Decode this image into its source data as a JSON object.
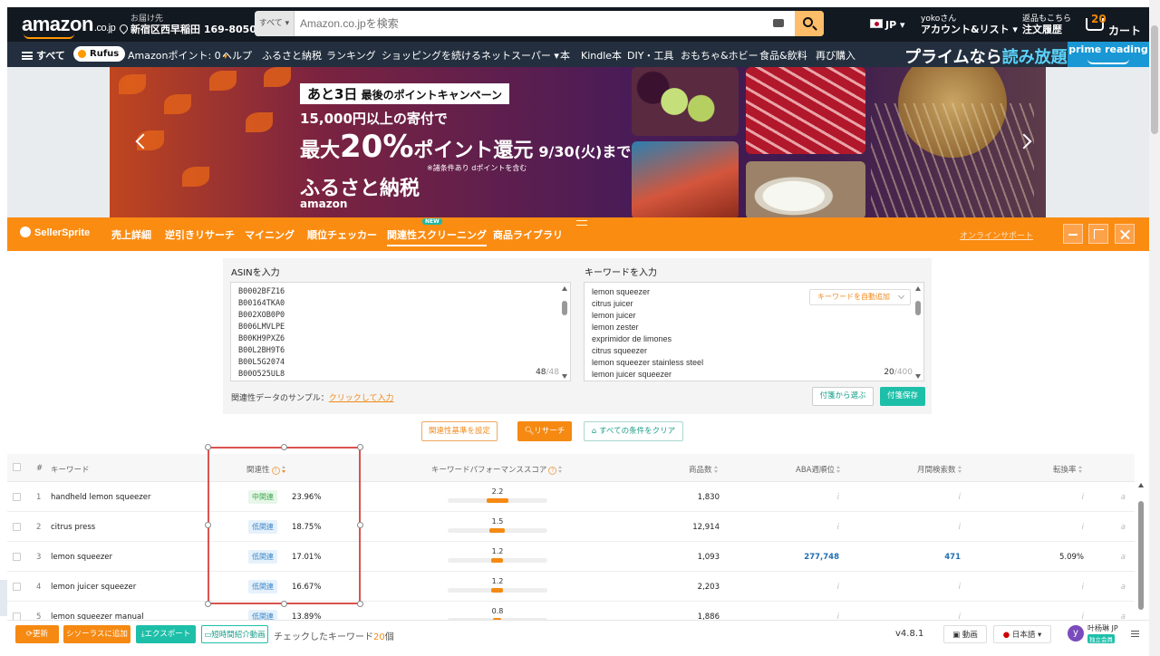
{
  "amazon": {
    "logo": "amazon",
    "logo_suffix": ".co.jp",
    "deliver_label": "お届け先",
    "deliver_addr": "新宿区西早稲田 169-8050",
    "search_category": "すべて",
    "search_placeholder": "Amazon.co.jpを検索",
    "lang": "JP",
    "account_hello": "yokoさん",
    "account_label": "アカウント&リスト",
    "returns_l1": "返品もこちら",
    "returns_l2": "注文履歴",
    "cart_count": "20",
    "cart_label": "カート"
  },
  "nav": {
    "all": "すべて",
    "rufus": "Rufus",
    "items": [
      "Amazonポイント: 0",
      "ヘルプ",
      "ふるさと納税",
      "ランキング",
      "ショッピングを続ける",
      "ネットスーパー",
      "本",
      "Kindle本",
      "DIY・工具",
      "おもちゃ&ホビー",
      "食品&飲料",
      "再び購入"
    ],
    "promo_a": "プライムなら",
    "promo_b": "読み放題",
    "prime_reading": "prime reading"
  },
  "banner": {
    "tag_a": "あと3日",
    "tag_b": "最後のポイントキャンペーン",
    "line2": "15,000円以上の寄付で",
    "line3_a": "最大",
    "line3_big": "20%",
    "line3_b": "ポイント還元",
    "line3_date": "9/30(火)まで",
    "note": "※諸条件あり dポイントを含む",
    "line4": "ふるさと納税",
    "brand": "amazon"
  },
  "sellersprite": {
    "logo": "SellerSprite",
    "tabs": [
      "売上詳細",
      "逆引きリサーチ",
      "マイニング",
      "順位チェッカー",
      "関連性スクリーニング",
      "商品ライブラリ"
    ],
    "new_badge": "NEW",
    "support": "オンラインサポート"
  },
  "form": {
    "asin_label": "ASINを入力",
    "keyword_label": "キーワードを入力",
    "asins": [
      "B0002BFZ16",
      "B00164TKA0",
      "B002XOB0P0",
      "B006LMVLPE",
      "B00KH9PXZ6",
      "B00L2BH9T6",
      "B00L5G2074",
      "B00O525UL8"
    ],
    "asin_count": "48",
    "asin_max": "/48",
    "keywords": [
      "lemon squeezer",
      "citrus juicer",
      "lemon juicer",
      "lemon zester",
      "exprimidor de limones",
      "citrus squeezer",
      "lemon squeezer stainless steel",
      "lemon juicer squeezer"
    ],
    "keyword_count": "20",
    "keyword_max": "/400",
    "auto_add": "キーワードを自動追加",
    "sample_label": "関連性データのサンプル：",
    "sample_link": "クリックして入力",
    "select_btn": "付箋から選ぶ",
    "save_btn": "付箋保存",
    "criteria_btn": "関連性基準を設定",
    "research_btn": "リサーチ",
    "clear_btn": "すべての条件をクリア"
  },
  "table": {
    "headers": {
      "idx": "#",
      "keyword": "キーワード",
      "relevance": "関連性",
      "kps": "キーワードパフォーマンススコア",
      "products": "商品数",
      "aba": "ABA週順位",
      "monthly": "月間検索数",
      "conversion": "転換率"
    },
    "rows": [
      {
        "idx": "1",
        "keyword": "handheld lemon squeezer",
        "level": "中関連",
        "pct": "23.96%",
        "score": "2.2",
        "products": "1,830",
        "aba": "i",
        "monthly": "i",
        "conv": "i"
      },
      {
        "idx": "2",
        "keyword": "citrus press",
        "level": "低関連",
        "pct": "18.75%",
        "score": "1.5",
        "products": "12,914",
        "aba": "i",
        "monthly": "i",
        "conv": "i"
      },
      {
        "idx": "3",
        "keyword": "lemon squeezer",
        "level": "低関連",
        "pct": "17.01%",
        "score": "1.2",
        "products": "1,093",
        "aba": "277,748",
        "monthly": "471",
        "conv": "5.09%"
      },
      {
        "idx": "4",
        "keyword": "lemon juicer squeezer",
        "level": "低関連",
        "pct": "16.67%",
        "score": "1.2",
        "products": "2,203",
        "aba": "i",
        "monthly": "i",
        "conv": "i"
      },
      {
        "idx": "5",
        "keyword": "lemon squeezer manual",
        "level": "低関連",
        "pct": "13.89%",
        "score": "0.8",
        "products": "1,886",
        "aba": "i",
        "monthly": "i",
        "conv": "i"
      }
    ],
    "trail": "a"
  },
  "footer": {
    "refresh": "更新",
    "thesaurus": "シソーラスに追加",
    "export": "エクスポート",
    "video": "短時間紹介動画",
    "checked_a": "チェックしたキーワード",
    "checked_n": "20",
    "checked_b": "個",
    "version": "v4.8.1",
    "video2": "動画",
    "language": "日本語",
    "avatar": "y",
    "user": "叶杨琳 JP",
    "member": "独立会員"
  },
  "colors": {
    "amazon_dark": "#131921",
    "amazon_nav": "#232f3e",
    "amazon_orange": "#ff9900",
    "ss_orange": "#fb8c12",
    "teal": "#1dbfa9",
    "selection_red": "#d9534f"
  }
}
